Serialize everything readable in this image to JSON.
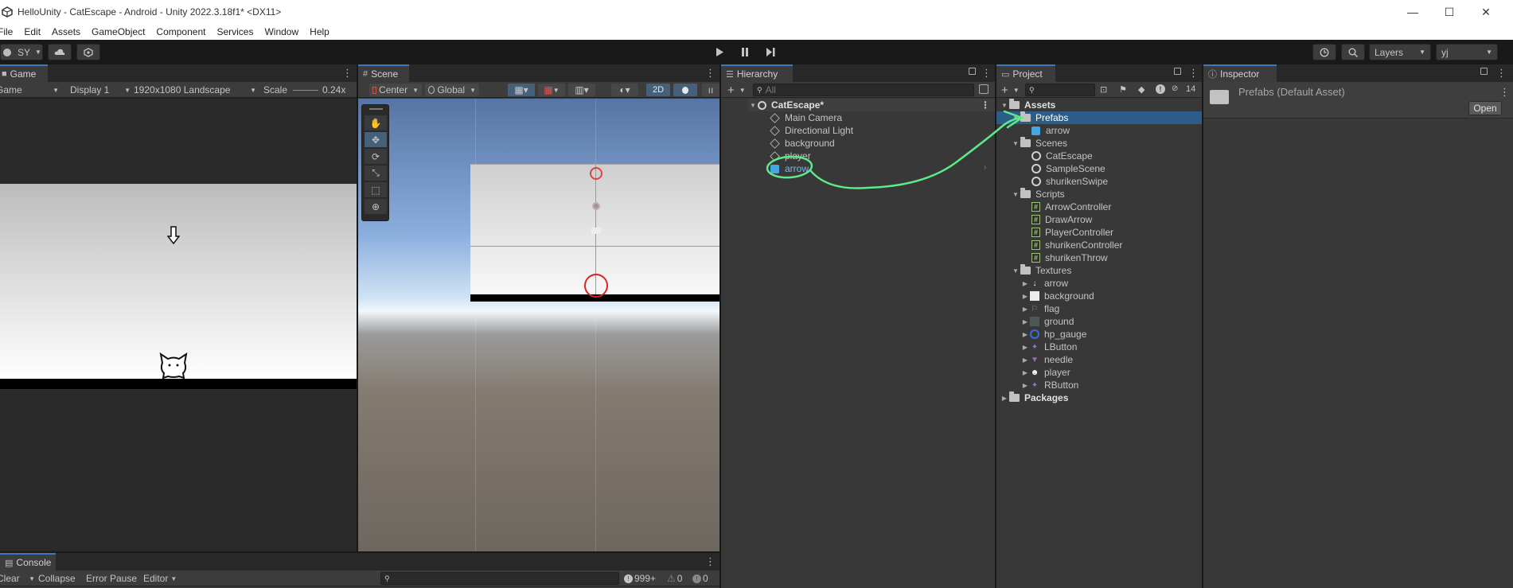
{
  "window": {
    "title": "HelloUnity - CatEscape - Android - Unity 2022.3.18f1* <DX11>",
    "minimize": "—",
    "maximize": "☐",
    "close": "✕"
  },
  "menu": [
    "File",
    "Edit",
    "Assets",
    "GameObject",
    "Component",
    "Services",
    "Window",
    "Help"
  ],
  "toolbar": {
    "account": "SY",
    "layers_label": "Layers",
    "layout_label": "yj"
  },
  "game": {
    "tab": "Game",
    "mode": "Game",
    "display": "Display 1",
    "resolution": "1920x1080 Landscape",
    "scale_label": "Scale",
    "scale_value": "0.24x"
  },
  "scene": {
    "tab": "Scene",
    "pivot": "Center",
    "space": "Global",
    "mode_2d": "2D"
  },
  "hierarchy": {
    "tab": "Hierarchy",
    "search_placeholder": "All",
    "scene_name": "CatEscape*",
    "items": [
      "Main Camera",
      "Directional Light",
      "background",
      "player",
      "arrow"
    ]
  },
  "project": {
    "tab": "Project",
    "hidden_count": "14",
    "assets": "Assets",
    "prefabs": "Prefabs",
    "prefab_items": [
      "arrow"
    ],
    "scenes": "Scenes",
    "scene_items": [
      "CatEscape",
      "SampleScene",
      "shurikenSwipe"
    ],
    "scripts": "Scripts",
    "script_items": [
      "ArrowController",
      "DrawArrow",
      "PlayerController",
      "shurikenController",
      "shurikenThrow"
    ],
    "textures": "Textures",
    "texture_items": [
      "arrow",
      "background",
      "flag",
      "ground",
      "hp_gauge",
      "LButton",
      "needle",
      "player",
      "RButton"
    ],
    "packages": "Packages"
  },
  "inspector": {
    "tab": "Inspector",
    "asset_title": "Prefabs (Default Asset)",
    "open_button": "Open"
  },
  "console": {
    "tab": "Console",
    "clear": "Clear",
    "collapse": "Collapse",
    "error_pause": "Error Pause",
    "editor": "Editor",
    "log_count": "999+",
    "warn_count": "0",
    "error_count": "0"
  },
  "colors": {
    "accent": "#3a79bb",
    "annotation": "#5dea88",
    "selection": "#2c5d87",
    "panel": "#383838"
  }
}
